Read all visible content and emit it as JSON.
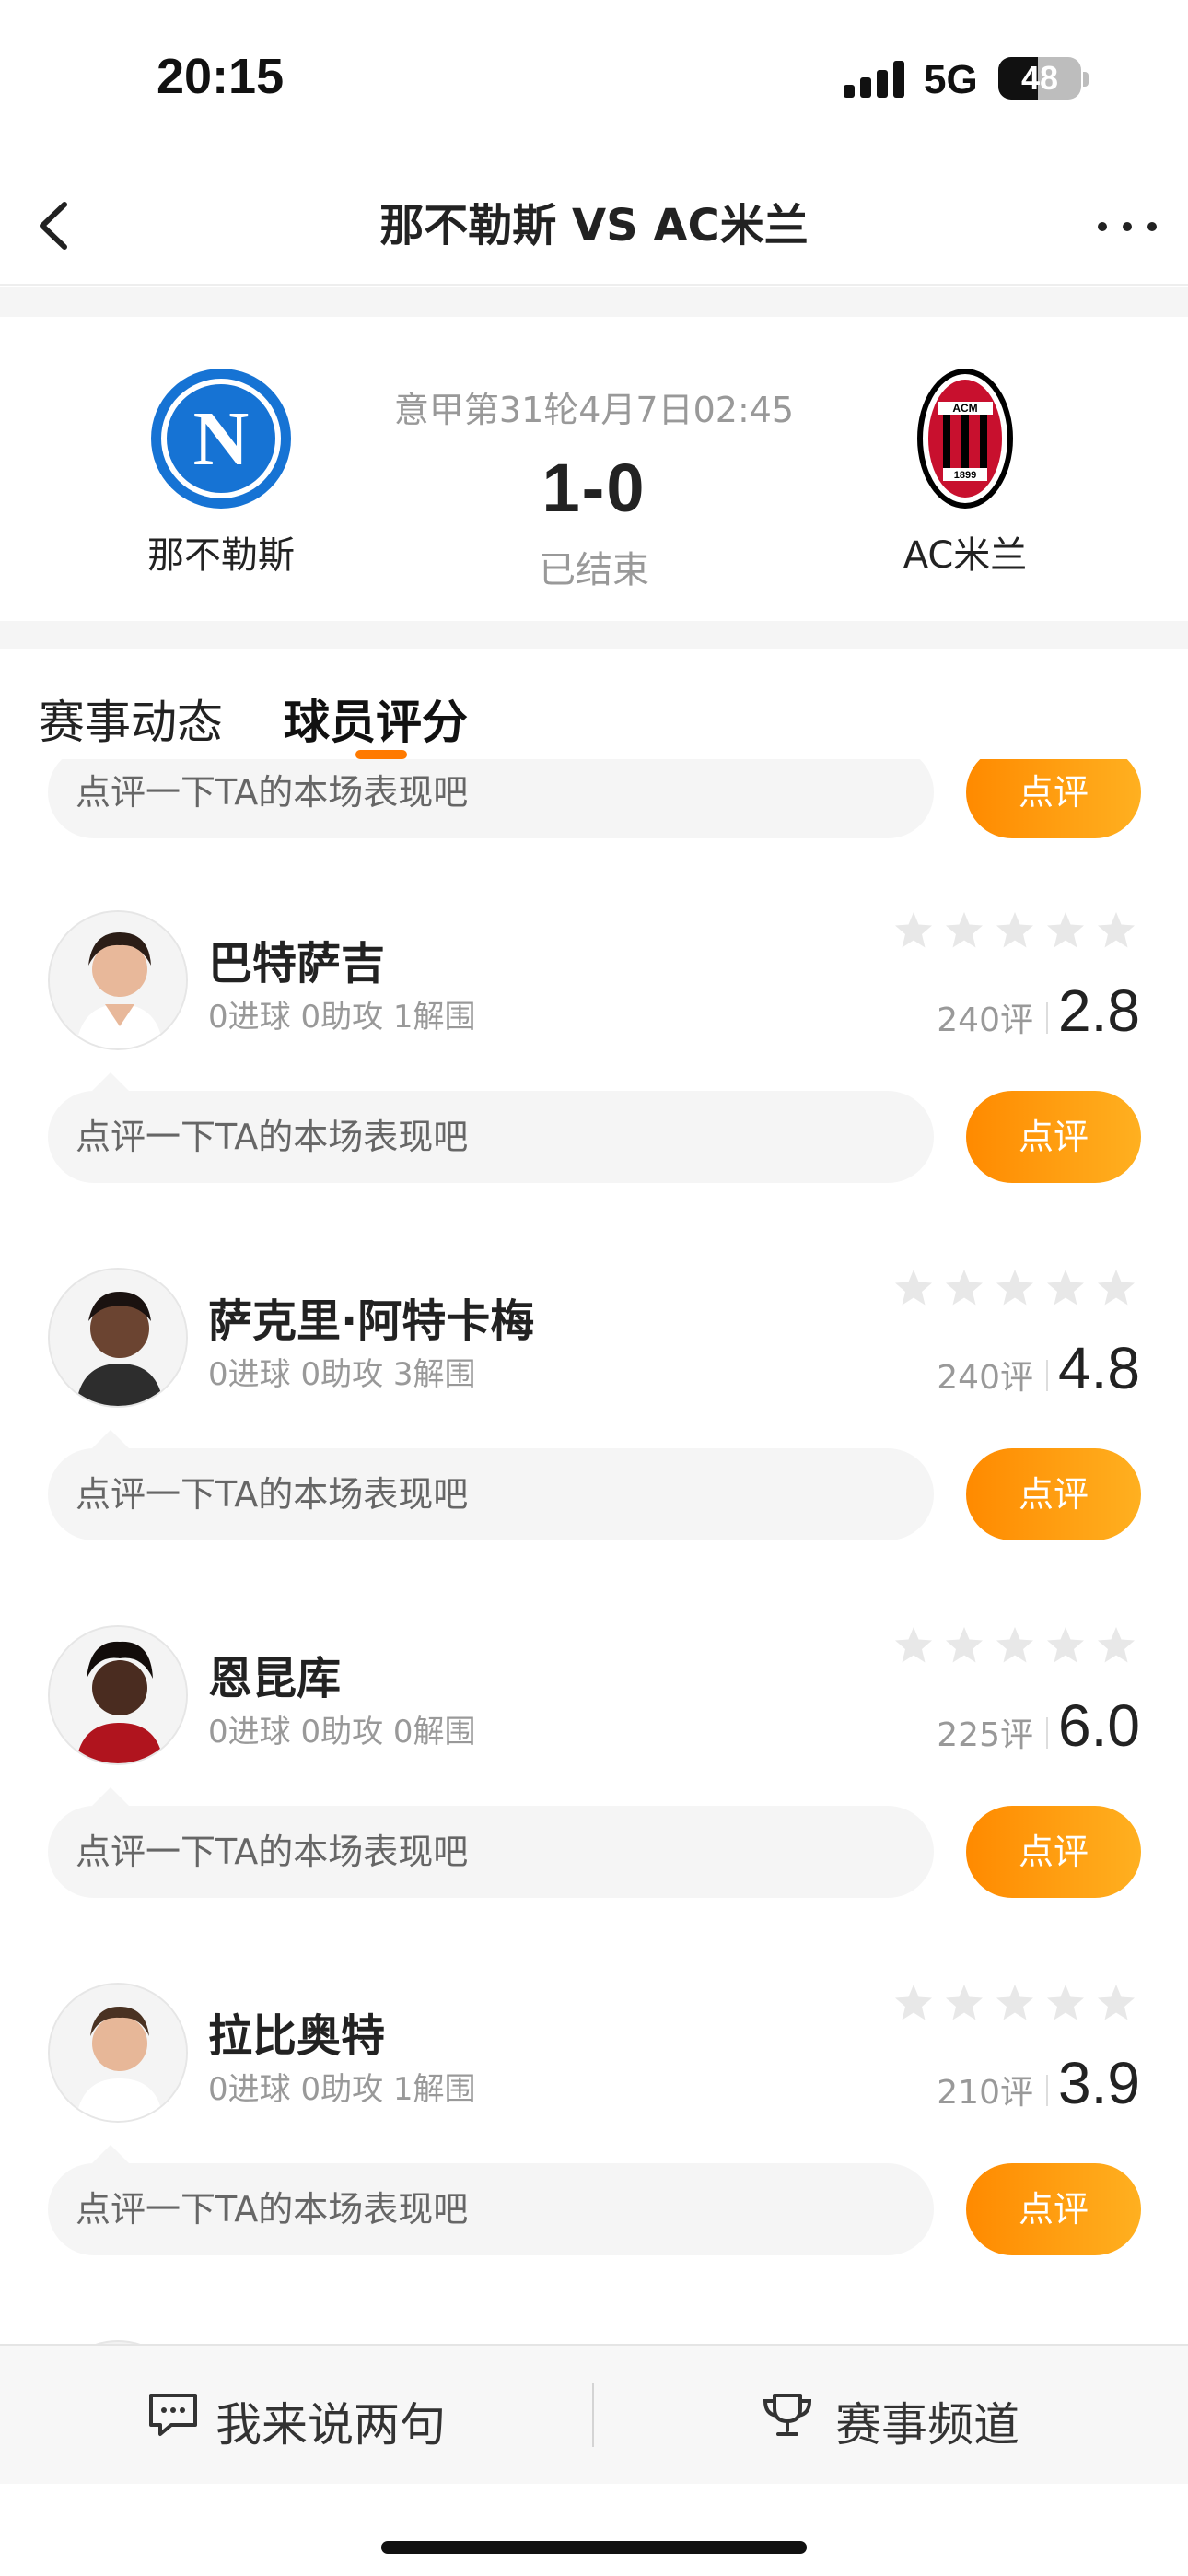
{
  "status_bar": {
    "time": "20:15",
    "network": "5G",
    "battery": "48",
    "battery_level": 0.48
  },
  "nav": {
    "title": "那不勒斯 VS AC米兰",
    "back_icon": "chevron-left-icon",
    "more_icon": "more-dots-icon"
  },
  "match": {
    "home": {
      "name": "那不勒斯",
      "logo": "napoli-logo"
    },
    "away": {
      "name": "AC米兰",
      "logo": "ac-milan-logo"
    },
    "info": "意甲第31轮4月7日02:45",
    "score": "1-0",
    "status": "已结束"
  },
  "tabs": [
    {
      "label": "赛事动态",
      "active": false
    },
    {
      "label": "球员评分",
      "active": true
    }
  ],
  "comment_placeholder": "点评一下TA的本场表现吧",
  "rate_label": "点评",
  "players": [
    {
      "name": "巴特萨吉",
      "stats": "0进球 0助攻 1解围",
      "reviews": "240评",
      "rating": "2.8"
    },
    {
      "name": "萨克里·阿特卡梅",
      "stats": "0进球 0助攻 3解围",
      "reviews": "240评",
      "rating": "4.8"
    },
    {
      "name": "恩昆库",
      "stats": "0进球 0助攻 0解围",
      "reviews": "225评",
      "rating": "6.0"
    },
    {
      "name": "拉比奥特",
      "stats": "0进球 0助攻 1解围",
      "reviews": "210评",
      "rating": "3.9"
    }
  ],
  "bottom_bar": {
    "comment": {
      "label": "我来说两句",
      "icon": "chat-icon"
    },
    "channel": {
      "label": "赛事频道",
      "icon": "trophy-icon"
    }
  },
  "colors": {
    "accent": "#ff8a00",
    "star": "#e8e8e8",
    "muted": "#999999"
  }
}
